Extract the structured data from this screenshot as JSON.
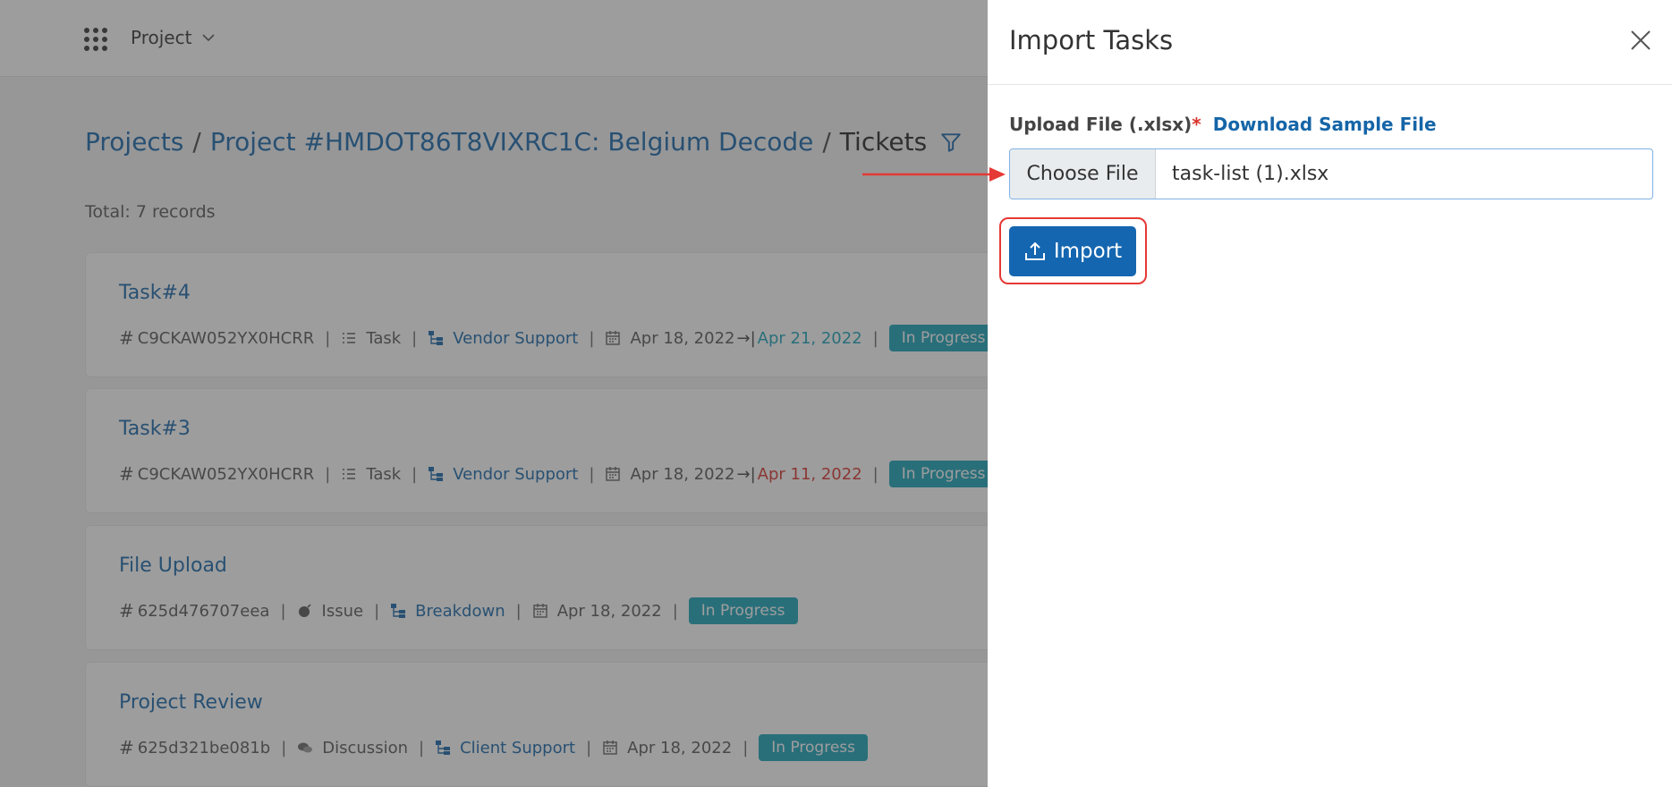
{
  "topbar": {
    "apps_icon": "grid-dots-icon",
    "project_menu_label": "Project"
  },
  "breadcrumb": {
    "projects": "Projects",
    "separator": "/",
    "project": "Project #HMDOT86T8VIXRC1C: Belgium Decode",
    "current": "Tickets",
    "filter_icon": "filter-icon"
  },
  "total": "Total: 7 records",
  "tickets": [
    {
      "title": "Task#4",
      "id": "C9CKAW052YX0HCRR",
      "type": "Task",
      "category": "Vendor Support",
      "start": "Apr 18, 2022",
      "due": "Apr 21, 2022",
      "status": "In Progress"
    },
    {
      "title": "Task#3",
      "id": "C9CKAW052YX0HCRR",
      "type": "Task",
      "category": "Vendor Support",
      "start": "Apr 18, 2022",
      "due": "Apr 11, 2022",
      "status": "In Progress"
    },
    {
      "title": "File Upload",
      "id": "625d476707eea",
      "type": "Issue",
      "category": "Breakdown",
      "start": "Apr 18, 2022",
      "status": "In Progress"
    },
    {
      "title": "Project Review",
      "id": "625d321be081b",
      "type": "Discussion",
      "category": "Client Support",
      "start": "Apr 18, 2022",
      "status": "In Progress"
    }
  ],
  "panel": {
    "title": "Import Tasks",
    "upload_label": "Upload File (.xlsx)",
    "required_mark": "*",
    "download_sample": "Download Sample File",
    "choose_file": "Choose File",
    "file_name": "task-list (1).xlsx",
    "import_label": "Import"
  },
  "colors": {
    "link": "#1565a8",
    "badge": "#17a2b8",
    "overdue": "#d9332b",
    "primary_button": "#1466b0",
    "highlight": "#e53935"
  }
}
